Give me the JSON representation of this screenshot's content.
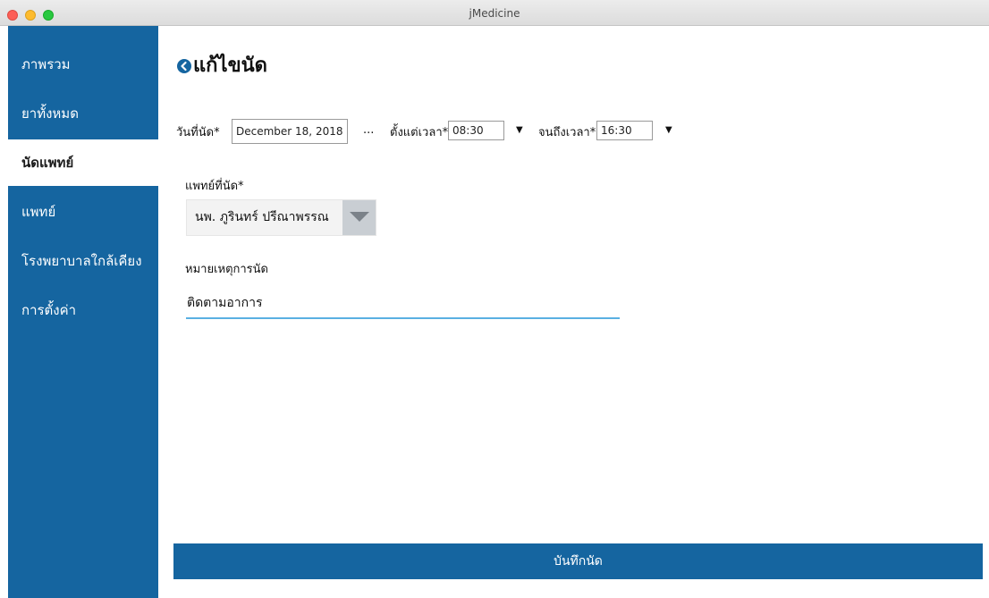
{
  "window": {
    "title": "jMedicine"
  },
  "sidebar": {
    "items": [
      {
        "label": "ภาพรวม"
      },
      {
        "label": "ยาทั้งหมด"
      },
      {
        "label": "นัดแพทย์"
      },
      {
        "label": "แพทย์"
      },
      {
        "label": "โรงพยาบาลใกล้เคียง"
      },
      {
        "label": "การตั้งค่า"
      }
    ],
    "active": "นัดแพทย์"
  },
  "page": {
    "title": "แก้ไขนัด"
  },
  "form": {
    "date_label": "วันที่นัด*",
    "date_value": "December 18, 2018",
    "date_picker_label": "...",
    "start_label": "ตั้งแต่เวลา*",
    "start_value": "08:30",
    "end_label": "จนถึงเวลา*",
    "end_value": "16:30",
    "caret": "▼",
    "doctor_label": "แพทย์ที่นัด*",
    "doctor_value": "นพ. ภูรินทร์ ปรีณาพรรณ",
    "note_label": "หมายเหตุการนัด",
    "note_value": "ติดตามอาการ"
  },
  "actions": {
    "save_label": "บันทึกนัด"
  },
  "colors": {
    "primary": "#1565a0",
    "accent_underline": "#5ab0e2"
  }
}
